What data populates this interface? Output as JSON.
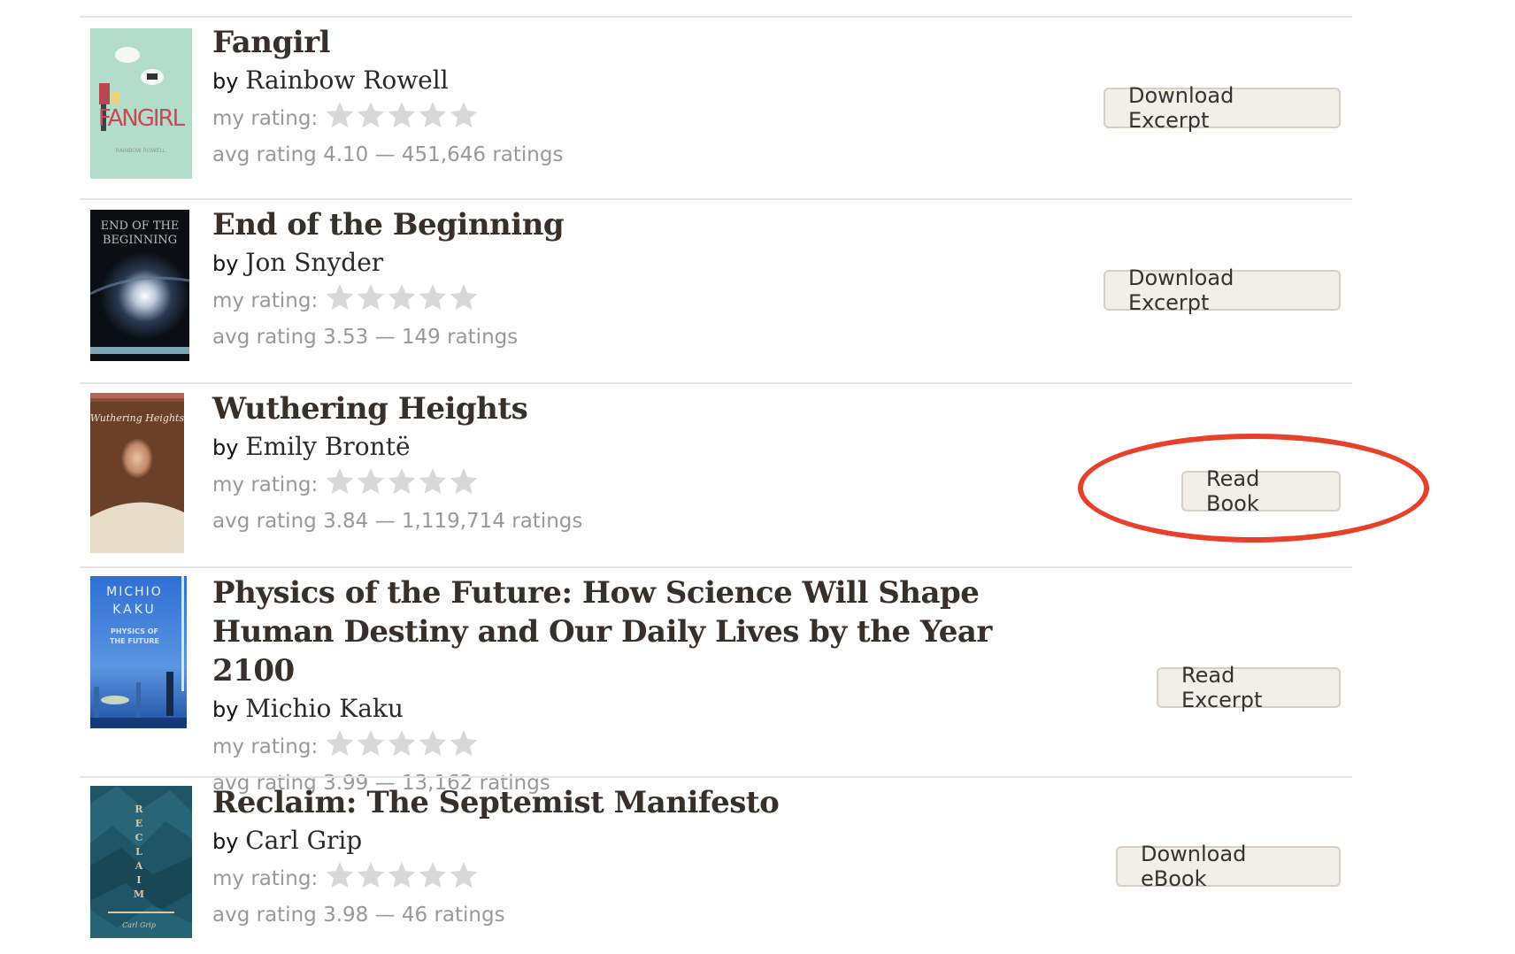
{
  "previous_row_partial_text": "avg rating — ratings",
  "my_rating_label": "my rating:",
  "books": [
    {
      "title": "Fangirl",
      "by": "by",
      "author": "Rainbow Rowell",
      "my_rating_stars": 0,
      "avg_rating_text": "avg rating 4.10 — 451,646 ratings",
      "avg_rating": 4.1,
      "ratings_count": "451,646",
      "action_label": "Download Excerpt",
      "cover_colors": {
        "bg": "#b3dccb",
        "accent": "#c94a55",
        "text": "#8a9a92"
      },
      "cover_text": "FANGIRL"
    },
    {
      "title": "End of the Beginning",
      "by": "by",
      "author": "Jon Snyder",
      "my_rating_stars": 0,
      "avg_rating_text": "avg rating 3.53 — 149 ratings",
      "avg_rating": 3.53,
      "ratings_count": "149",
      "action_label": "Download Excerpt",
      "cover_colors": {
        "bg": "#0b0f14",
        "accent": "#dfe8f2",
        "text": "#b8bec6"
      },
      "cover_text": "END OF THE BEGINNING"
    },
    {
      "title": "Wuthering Heights",
      "by": "by",
      "author": "Emily Brontë",
      "my_rating_stars": 0,
      "avg_rating_text": "avg rating 3.84 — 1,119,714 ratings",
      "avg_rating": 3.84,
      "ratings_count": "1,119,714",
      "action_label": "Read Book",
      "cover_colors": {
        "bg": "#6b4029",
        "accent": "#e7dcc8",
        "text": "#f0e6d6"
      },
      "cover_text": "Wuthering Heights",
      "highlighted": true
    },
    {
      "title": "Physics of the Future: How Science Will Shape Human Destiny and Our Daily Lives by the Year 2100",
      "by": "by",
      "author": "Michio Kaku",
      "my_rating_stars": 0,
      "avg_rating_text": "avg rating 3.99 — 13,162 ratings",
      "avg_rating": 3.99,
      "ratings_count": "13,162",
      "action_label": "Read Excerpt",
      "cover_colors": {
        "bg": "#2f6fd6",
        "accent": "#cfe3f7",
        "text": "#e6f0fb"
      },
      "cover_text": "MICHIO KAKU"
    },
    {
      "title": "Reclaim: The Septemist Manifesto",
      "by": "by",
      "author": "Carl Grip",
      "my_rating_stars": 0,
      "avg_rating_text": "avg rating 3.98 — 46 ratings",
      "avg_rating": 3.98,
      "ratings_count": "46",
      "action_label": "Download eBook",
      "cover_colors": {
        "bg": "#1f5566",
        "accent": "#d9c9a0",
        "text": "#d9c9a0"
      },
      "cover_text": "RECLAIM"
    }
  ],
  "colors": {
    "title": "#382f2a",
    "meta_gray": "#999999",
    "star_empty": "#d8d8d8",
    "button_bg": "#f2efe9",
    "button_border": "#d6d0c4",
    "divider": "#e6e6e6",
    "annotation_red": "#e8402a"
  }
}
